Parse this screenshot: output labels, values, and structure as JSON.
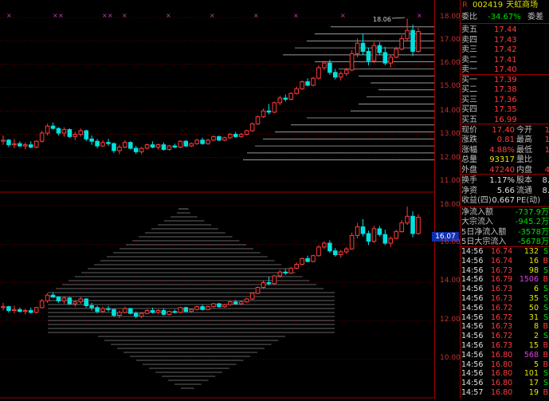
{
  "header": {
    "r_marker": "R",
    "code": "002419",
    "name": "天虹商场",
    "top_price": "18.06"
  },
  "axis_top": [
    "18.00",
    "17.00",
    "16.00",
    "15.00",
    "14.00",
    "13.00",
    "12.00",
    "11.00"
  ],
  "axis_bottom": [
    "18.00",
    "16.00",
    "14.00",
    "12.00",
    "10.00"
  ],
  "current_price_tag": "16.07",
  "commission": {
    "ratio_label": "委比",
    "ratio_value": "-34.67%",
    "diff_label": "委差"
  },
  "sell": [
    {
      "label": "卖五",
      "price": "17.44"
    },
    {
      "label": "卖四",
      "price": "17.43"
    },
    {
      "label": "卖三",
      "price": "17.42"
    },
    {
      "label": "卖二",
      "price": "17.41"
    },
    {
      "label": "卖一",
      "price": "17.40"
    }
  ],
  "buy": [
    {
      "label": "买一",
      "price": "17.39"
    },
    {
      "label": "买二",
      "price": "17.38"
    },
    {
      "label": "买三",
      "price": "17.36"
    },
    {
      "label": "买四",
      "price": "17.35"
    },
    {
      "label": "买五",
      "price": "16.99"
    }
  ],
  "quote": [
    {
      "l1": "现价",
      "v1": "17.40",
      "l2": "今开",
      "v2": "1"
    },
    {
      "l1": "涨跌",
      "v1": "0.81",
      "l2": "最高",
      "v2": "1"
    },
    {
      "l1": "涨幅",
      "v1": "4.88%",
      "l2": "最低",
      "v2": "1"
    },
    {
      "l1": "总量",
      "v1": "93317",
      "l2": "量比",
      "v2": ""
    },
    {
      "l1": "外盘",
      "v1": "47240",
      "l2": "内盘",
      "v2": "4"
    }
  ],
  "quote2": [
    {
      "l1": "换手",
      "v1": "1.17%",
      "l2": "股本",
      "v2": "8."
    },
    {
      "l1": "净资",
      "v1": "5.66",
      "l2": "流通",
      "v2": "8."
    },
    {
      "l1": "收益(四)",
      "v1": "0.667",
      "l2": "PE(动)",
      "v2": ""
    }
  ],
  "flows": [
    {
      "label": "净流入额",
      "value": "-737.9万"
    },
    {
      "label": "大宗流入",
      "value": "-945.2万"
    },
    {
      "label": "5日净流入额",
      "value": "-3578万"
    },
    {
      "label": "5日大宗流入",
      "value": "-5678万"
    }
  ],
  "ticks": [
    {
      "time": "14:56",
      "price": "16.74",
      "vol": "132",
      "side": "S"
    },
    {
      "time": "14:56",
      "price": "16.74",
      "vol": "16",
      "side": "B"
    },
    {
      "time": "14:56",
      "price": "16.73",
      "vol": "98",
      "side": "S"
    },
    {
      "time": "14:56",
      "price": "16.79",
      "vol": "1506",
      "side": "B"
    },
    {
      "time": "14:56",
      "price": "16.73",
      "vol": "6",
      "side": "S"
    },
    {
      "time": "14:56",
      "price": "16.73",
      "vol": "35",
      "side": "S"
    },
    {
      "time": "14:56",
      "price": "16.72",
      "vol": "50",
      "side": "S"
    },
    {
      "time": "14:56",
      "price": "16.72",
      "vol": "31",
      "side": "S"
    },
    {
      "time": "14:56",
      "price": "16.73",
      "vol": "8",
      "side": "B"
    },
    {
      "time": "14:56",
      "price": "16.72",
      "vol": "2",
      "side": "S"
    },
    {
      "time": "14:56",
      "price": "16.73",
      "vol": "15",
      "side": "B"
    },
    {
      "time": "14:56",
      "price": "16.80",
      "vol": "568",
      "side": "B"
    },
    {
      "time": "14:56",
      "price": "16.80",
      "vol": "5",
      "side": "B"
    },
    {
      "time": "14:56",
      "price": "16.80",
      "vol": "101",
      "side": "S"
    },
    {
      "time": "14:56",
      "price": "16.80",
      "vol": "17",
      "side": "S"
    },
    {
      "time": "14:57",
      "price": "16.80",
      "vol": "19",
      "side": "B"
    }
  ],
  "colors": {
    "up": "#ff3c3c",
    "down": "#00e0e0",
    "grid": "#a00000",
    "profile": "#c8c8c8",
    "bg": "#000000"
  },
  "chart_data": {
    "type": "candlestick",
    "top_ylim": [
      11.0,
      18.2
    ],
    "bottom_ylim": [
      9.6,
      18.6
    ],
    "candles": [
      [
        12.7,
        12.95,
        12.55,
        12.75
      ],
      [
        12.75,
        12.8,
        12.45,
        12.55
      ],
      [
        12.55,
        12.8,
        12.4,
        12.6
      ],
      [
        12.6,
        12.7,
        12.45,
        12.5
      ],
      [
        12.5,
        12.65,
        12.35,
        12.55
      ],
      [
        12.55,
        12.7,
        12.4,
        12.45
      ],
      [
        12.45,
        12.75,
        12.4,
        12.7
      ],
      [
        12.7,
        13.15,
        12.65,
        13.05
      ],
      [
        13.05,
        13.45,
        12.95,
        13.35
      ],
      [
        13.35,
        13.5,
        13.2,
        13.25
      ],
      [
        13.25,
        13.3,
        12.95,
        13.05
      ],
      [
        13.05,
        13.3,
        12.9,
        13.2
      ],
      [
        13.2,
        13.25,
        12.85,
        12.9
      ],
      [
        12.9,
        13.1,
        12.75,
        13.0
      ],
      [
        13.0,
        13.25,
        12.9,
        13.15
      ],
      [
        13.15,
        13.2,
        12.7,
        12.8
      ],
      [
        12.8,
        12.95,
        12.55,
        12.7
      ],
      [
        12.7,
        12.8,
        12.4,
        12.5
      ],
      [
        12.5,
        12.75,
        12.45,
        12.65
      ],
      [
        12.65,
        12.8,
        12.5,
        12.6
      ],
      [
        12.6,
        12.65,
        12.2,
        12.3
      ],
      [
        12.3,
        12.55,
        12.15,
        12.45
      ],
      [
        12.45,
        12.75,
        12.4,
        12.65
      ],
      [
        12.65,
        12.7,
        12.35,
        12.4
      ],
      [
        12.4,
        12.5,
        12.15,
        12.25
      ],
      [
        12.25,
        12.45,
        12.15,
        12.4
      ],
      [
        12.4,
        12.6,
        12.35,
        12.55
      ],
      [
        12.55,
        12.7,
        12.4,
        12.45
      ],
      [
        12.45,
        12.6,
        12.35,
        12.55
      ],
      [
        12.55,
        12.65,
        12.3,
        12.35
      ],
      [
        12.35,
        12.55,
        12.3,
        12.5
      ],
      [
        12.5,
        12.6,
        12.4,
        12.45
      ],
      [
        12.45,
        12.75,
        12.4,
        12.7
      ],
      [
        12.7,
        12.75,
        12.45,
        12.5
      ],
      [
        12.5,
        12.65,
        12.45,
        12.6
      ],
      [
        12.6,
        12.8,
        12.55,
        12.75
      ],
      [
        12.75,
        12.85,
        12.55,
        12.6
      ],
      [
        12.6,
        12.8,
        12.55,
        12.75
      ],
      [
        12.75,
        12.95,
        12.7,
        12.9
      ],
      [
        12.9,
        12.95,
        12.7,
        12.75
      ],
      [
        12.75,
        12.9,
        12.7,
        12.85
      ],
      [
        12.85,
        13.05,
        12.8,
        13.0
      ],
      [
        13.0,
        13.1,
        12.85,
        12.9
      ],
      [
        12.9,
        13.05,
        12.85,
        13.0
      ],
      [
        13.0,
        13.2,
        12.95,
        13.15
      ],
      [
        13.15,
        13.5,
        13.1,
        13.45
      ],
      [
        13.45,
        13.8,
        13.4,
        13.75
      ],
      [
        13.75,
        14.1,
        13.7,
        14.0
      ],
      [
        14.0,
        14.3,
        13.85,
        13.95
      ],
      [
        13.95,
        14.4,
        13.9,
        14.35
      ],
      [
        14.35,
        14.65,
        14.25,
        14.55
      ],
      [
        14.55,
        14.7,
        14.4,
        14.5
      ],
      [
        14.5,
        14.8,
        14.45,
        14.75
      ],
      [
        14.75,
        15.05,
        14.7,
        14.95
      ],
      [
        14.95,
        15.3,
        14.9,
        15.25
      ],
      [
        15.25,
        15.4,
        15.05,
        15.1
      ],
      [
        15.1,
        15.45,
        15.05,
        15.4
      ],
      [
        15.4,
        15.95,
        15.35,
        15.85
      ],
      [
        15.85,
        16.15,
        15.75,
        16.05
      ],
      [
        16.05,
        16.2,
        15.55,
        15.65
      ],
      [
        15.65,
        15.8,
        15.35,
        15.45
      ],
      [
        15.45,
        15.7,
        15.3,
        15.6
      ],
      [
        15.6,
        15.85,
        15.5,
        15.75
      ],
      [
        15.75,
        16.6,
        15.7,
        16.45
      ],
      [
        16.45,
        17.1,
        16.3,
        16.9
      ],
      [
        16.9,
        17.3,
        16.4,
        16.55
      ],
      [
        16.55,
        16.7,
        15.95,
        16.15
      ],
      [
        16.15,
        16.95,
        16.05,
        16.8
      ],
      [
        16.8,
        16.95,
        16.4,
        16.5
      ],
      [
        16.5,
        16.75,
        15.95,
        16.05
      ],
      [
        16.05,
        16.4,
        15.85,
        16.3
      ],
      [
        16.3,
        16.75,
        16.25,
        16.65
      ],
      [
        16.65,
        17.25,
        16.6,
        17.1
      ],
      [
        17.1,
        17.95,
        17.0,
        17.45
      ],
      [
        17.45,
        17.7,
        16.35,
        16.55
      ],
      [
        16.55,
        17.55,
        16.5,
        17.4
      ]
    ]
  }
}
